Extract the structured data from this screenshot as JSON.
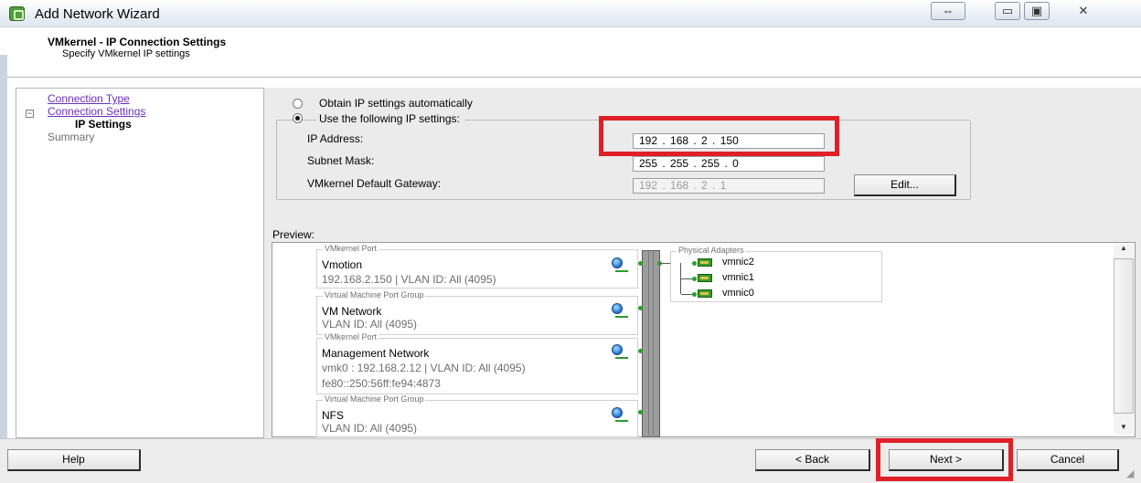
{
  "window": {
    "title": "Add Network Wizard",
    "controls": [
      "⇔",
      "▭",
      "▣",
      "✕"
    ]
  },
  "header": {
    "title": "VMkernel - IP Connection Settings",
    "subtitle": "Specify VMkernel IP settings"
  },
  "nav": {
    "items": [
      {
        "label": "Connection Type"
      },
      {
        "label": "Connection Settings",
        "toggle": "−"
      },
      {
        "label": "IP Settings"
      },
      {
        "label": "Summary"
      }
    ]
  },
  "ip_settings": {
    "option_auto": "Obtain IP settings automatically",
    "option_manual": "Use the following IP settings:",
    "ip_address_label": "IP Address:",
    "ip_address": "192 . 168 .  2  . 150",
    "subnet_mask_label": "Subnet Mask:",
    "subnet_mask": "255 . 255 . 255 .  0",
    "gateway_label": "VMkernel Default Gateway:",
    "gateway": "192 . 168 .  2  .  1",
    "edit_label": "Edit..."
  },
  "preview": {
    "label": "Preview:",
    "port_groups": [
      {
        "legend": "VMkernel Port",
        "name": "Vmotion",
        "info": [
          "192.168.2.150 | VLAN ID: All (4095)"
        ]
      },
      {
        "legend": "Virtual Machine Port Group",
        "name": "VM Network",
        "info": [
          "VLAN ID: All (4095)"
        ]
      },
      {
        "legend": "VMkernel Port",
        "name": "Management Network",
        "info": [
          "vmk0 : 192.168.2.12 | VLAN ID: All (4095)",
          "fe80::250:56ff:fe94:4873"
        ]
      },
      {
        "legend": "Virtual Machine Port Group",
        "name": "NFS",
        "info": [
          "VLAN ID: All (4095)"
        ]
      }
    ],
    "physical_adapters": {
      "legend": "Physical Adapters",
      "adapters": [
        "vmnic2",
        "vmnic1",
        "vmnic0"
      ]
    }
  },
  "footer": {
    "help": "Help",
    "back": "< Back",
    "next": "Next >",
    "cancel": "Cancel"
  },
  "colors": {
    "highlight": "#e01f26",
    "nav_link": "#6b2fbf",
    "adapter_green": "#3b9a2e"
  }
}
